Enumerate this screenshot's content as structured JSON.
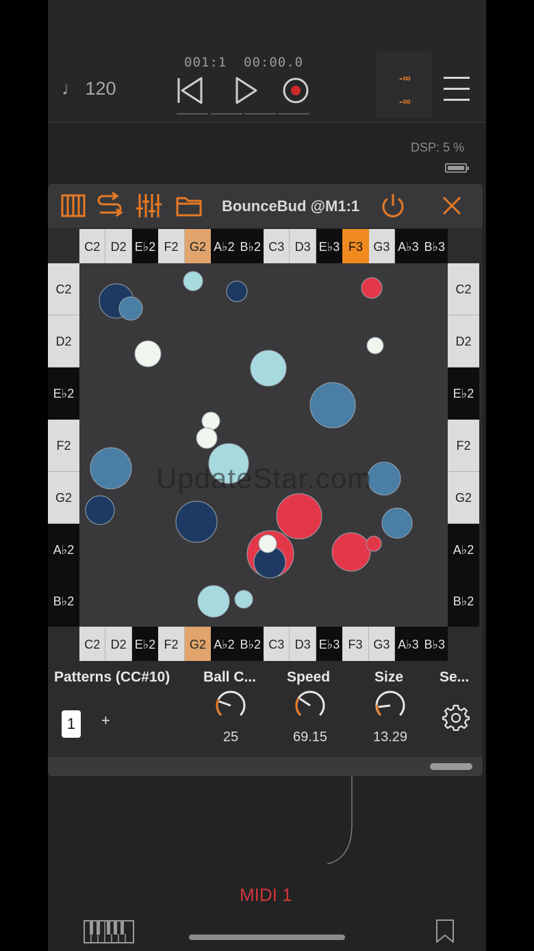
{
  "colors": {
    "accent": "#e67a26",
    "record": "#d02a2a",
    "midi_red": "#d2363c",
    "ball_navy": "#1e3a63",
    "ball_steel": "#4a7ea5",
    "ball_cyan": "#a6dadf",
    "ball_white": "#f0f5ee",
    "ball_red": "#e3384a"
  },
  "transport": {
    "tempo": "♩ 120",
    "position": "001:1",
    "time": "00:00.0",
    "meter_top": "-∞",
    "meter_bottom": "-∞"
  },
  "status": {
    "dsp_label": "DSP:  5 %"
  },
  "plugin": {
    "title": "BounceBud @M1:1",
    "toolbar_icons": [
      "piano-icon",
      "routing-icon",
      "mixer-sliders-icon",
      "folder-icon",
      "power-icon",
      "close-icon"
    ]
  },
  "horizontal_keys": [
    {
      "label": "C2",
      "kind": "w"
    },
    {
      "label": "D2",
      "kind": "w"
    },
    {
      "label": "E♭2",
      "kind": "b"
    },
    {
      "label": "F2",
      "kind": "w"
    },
    {
      "label": "G2",
      "kind": "g2"
    },
    {
      "label": "A♭2",
      "kind": "b"
    },
    {
      "label": "B♭2",
      "kind": "b"
    },
    {
      "label": "C3",
      "kind": "w"
    },
    {
      "label": "D3",
      "kind": "w"
    },
    {
      "label": "E♭3",
      "kind": "b"
    },
    {
      "label": "F3",
      "kind": "f3"
    },
    {
      "label": "G3",
      "kind": "w"
    },
    {
      "label": "A♭3",
      "kind": "b"
    },
    {
      "label": "B♭3",
      "kind": "b"
    }
  ],
  "bottom_keys": [
    {
      "label": "C2",
      "kind": "w"
    },
    {
      "label": "D2",
      "kind": "w"
    },
    {
      "label": "E♭2",
      "kind": "b"
    },
    {
      "label": "F2",
      "kind": "w"
    },
    {
      "label": "G2",
      "kind": "g2"
    },
    {
      "label": "A♭2",
      "kind": "b"
    },
    {
      "label": "B♭2",
      "kind": "b"
    },
    {
      "label": "C3",
      "kind": "w"
    },
    {
      "label": "D3",
      "kind": "w"
    },
    {
      "label": "E♭3",
      "kind": "b"
    },
    {
      "label": "F3",
      "kind": "w"
    },
    {
      "label": "G3",
      "kind": "w"
    },
    {
      "label": "A♭3",
      "kind": "b"
    },
    {
      "label": "B♭3",
      "kind": "b"
    }
  ],
  "vertical_keys": [
    {
      "label": "C2",
      "kind": "w"
    },
    {
      "label": "D2",
      "kind": "w"
    },
    {
      "label": "E♭2",
      "kind": "b"
    },
    {
      "label": "F2",
      "kind": "w"
    },
    {
      "label": "G2",
      "kind": "w"
    },
    {
      "label": "A♭2",
      "kind": "b"
    },
    {
      "label": "B♭2",
      "kind": "b"
    }
  ],
  "controls": {
    "patterns_label": "Patterns (CC#10)",
    "pattern_number": "1",
    "add_label": "+",
    "ball_count_label": "Ball C...",
    "ball_count_value": "25",
    "speed_label": "Speed",
    "speed_value": "69.15",
    "size_label": "Size",
    "size_value": "13.29",
    "settings_label": "Se..."
  },
  "watermark": "UpdateStar.com",
  "footer": {
    "track_name": "MIDI 1"
  }
}
